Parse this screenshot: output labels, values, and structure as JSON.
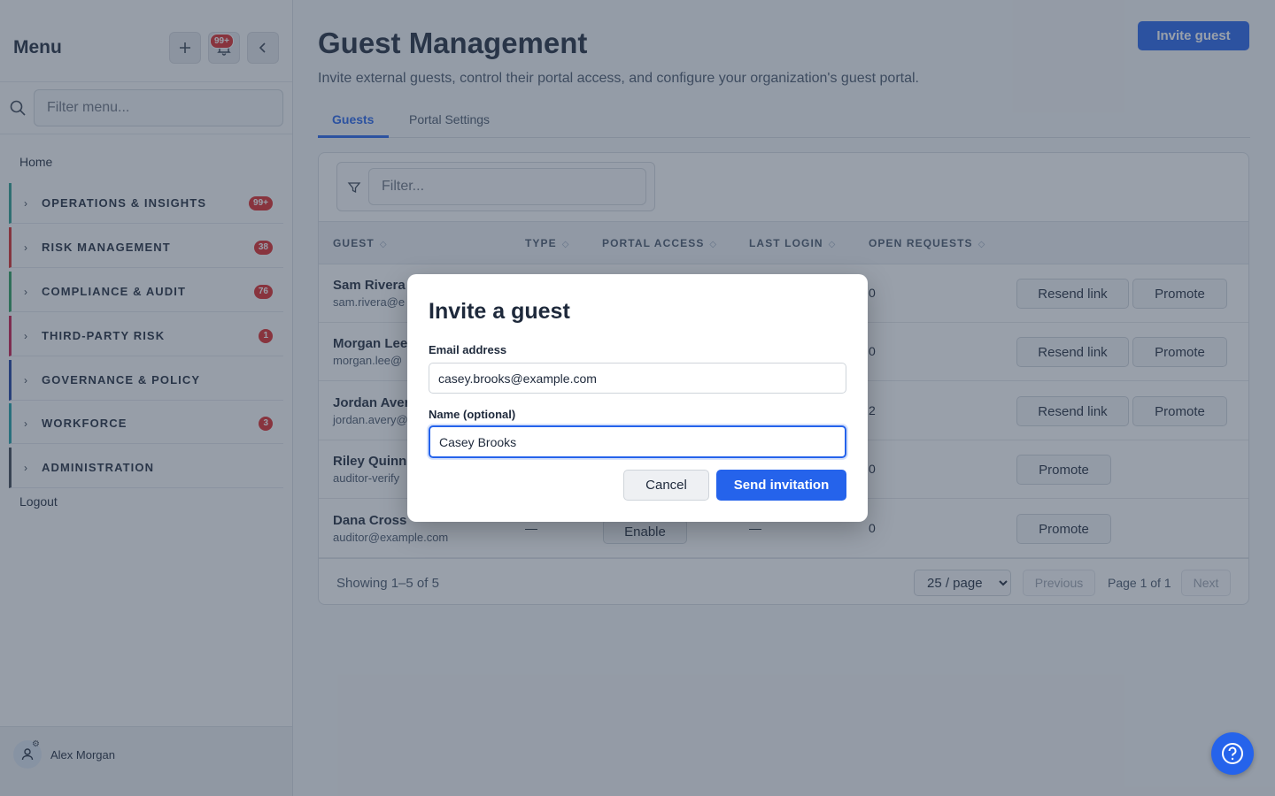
{
  "sidebar": {
    "title": "Menu",
    "add_icon": "plus-icon",
    "notifications_badge": "99+",
    "collapse_icon": "chevron-left-icon",
    "filter_placeholder": "Filter menu...",
    "home": "Home",
    "groups": [
      {
        "label": "OPERATIONS & INSIGHTS",
        "count": "99+",
        "color": "#2a9d8f"
      },
      {
        "label": "RISK MANAGEMENT",
        "count": "38",
        "color": "#d62828"
      },
      {
        "label": "COMPLIANCE & AUDIT",
        "count": "76",
        "color": "#2a9d5c"
      },
      {
        "label": "THIRD-PARTY RISK",
        "count": "1",
        "color": "#c9184a"
      },
      {
        "label": "GOVERNANCE & POLICY",
        "count": "",
        "color": "#1d3f9e"
      },
      {
        "label": "WORKFORCE",
        "count": "3",
        "color": "#1f9ea5"
      },
      {
        "label": "ADMINISTRATION",
        "count": "",
        "color": "#3d4451"
      }
    ],
    "logout": "Logout",
    "user_name": "Alex Morgan"
  },
  "header": {
    "title": "Guest Management",
    "subtitle": "Invite external guests, control their portal access, and configure your organization's guest portal.",
    "invite_button": "Invite guest"
  },
  "tabs": [
    {
      "label": "Guests",
      "active": true
    },
    {
      "label": "Portal Settings",
      "active": false
    }
  ],
  "table": {
    "filter_placeholder": "Filter...",
    "columns": [
      "GUEST",
      "TYPE",
      "PORTAL ACCESS",
      "LAST LOGIN",
      "OPEN REQUESTS"
    ],
    "rows": [
      {
        "name": "Sam Rivera",
        "email": "sam.rivera@e",
        "requests": "0",
        "actions": [
          "Resend link",
          "Promote"
        ]
      },
      {
        "name": "Morgan Lee",
        "email": "morgan.lee@",
        "requests": "0",
        "actions": [
          "Resend link",
          "Promote"
        ]
      },
      {
        "name": "Jordan Aver",
        "email": "jordan.avery@",
        "requests": "2",
        "actions": [
          "Resend link",
          "Promote"
        ]
      },
      {
        "name": "Riley Quinn",
        "email": "auditor-verify",
        "requests": "0",
        "actions": [
          "Promote"
        ]
      },
      {
        "name": "Dana Cross",
        "email": "auditor@example.com",
        "type": "—",
        "access": "Enable",
        "last_login": "—",
        "requests": "0",
        "actions": [
          "Promote"
        ]
      }
    ],
    "showing": "Showing 1–5 of 5",
    "page_size": "25 / page",
    "previous": "Previous",
    "page_of": "Page 1 of 1",
    "next": "Next"
  },
  "modal": {
    "title": "Invite a guest",
    "email_label": "Email address",
    "email_value": "casey.brooks@example.com",
    "name_label": "Name (optional)",
    "name_value": "Casey Brooks",
    "cancel": "Cancel",
    "send": "Send invitation"
  },
  "colors": {
    "accent": "#2563eb",
    "badge": "#dc2626"
  }
}
